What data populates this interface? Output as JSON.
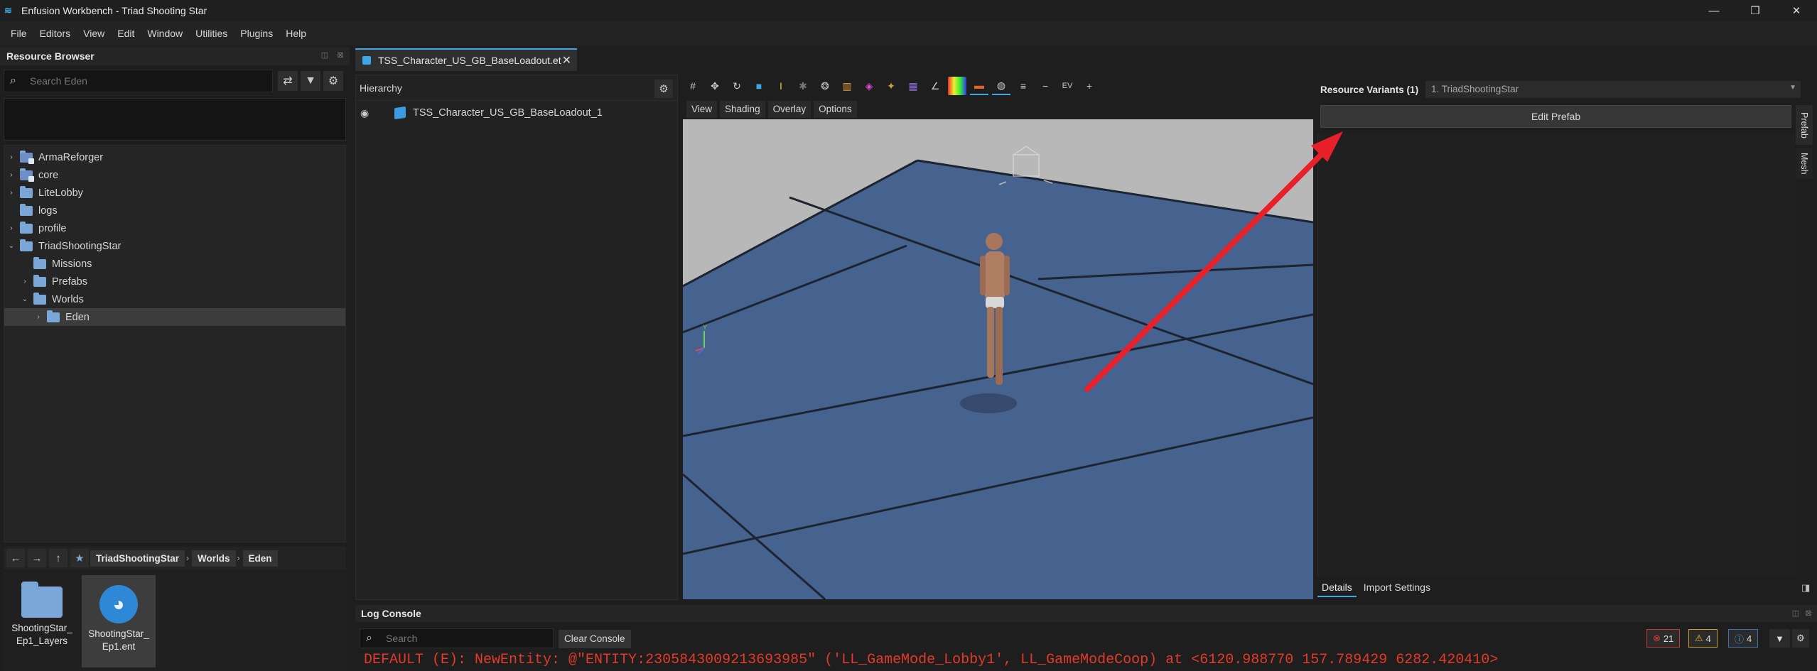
{
  "window": {
    "title": "Enfusion Workbench - Triad Shooting Star",
    "minimize": "—",
    "maximize": "❐",
    "close": "✕"
  },
  "menu": [
    "File",
    "Editors",
    "View",
    "Edit",
    "Window",
    "Utilities",
    "Plugins",
    "Help"
  ],
  "resource_browser": {
    "title": "Resource Browser",
    "search_placeholder": "Search Eden",
    "tree": [
      {
        "label": "ArmaReforger",
        "arrow": "›",
        "kind": "pkg"
      },
      {
        "label": "core",
        "arrow": "›",
        "kind": "pkg"
      },
      {
        "label": "LiteLobby",
        "arrow": "›",
        "kind": "folder"
      },
      {
        "label": "logs",
        "arrow": "",
        "kind": "folder"
      },
      {
        "label": "profile",
        "arrow": "›",
        "kind": "folder"
      },
      {
        "label": "TriadShootingStar",
        "arrow": "⌄",
        "kind": "folder"
      },
      {
        "label": "Missions",
        "arrow": "",
        "kind": "folder"
      },
      {
        "label": "Prefabs",
        "arrow": "›",
        "kind": "folder"
      },
      {
        "label": "Worlds",
        "arrow": "⌄",
        "kind": "folder"
      },
      {
        "label": "Eden",
        "arrow": "›",
        "kind": "folder"
      }
    ],
    "breadcrumb": [
      "TriadShootingStar",
      "Worlds",
      "Eden"
    ],
    "files": [
      {
        "line1": "ShootingStar_",
        "line2": "Ep1_Layers"
      },
      {
        "line1": "ShootingStar_",
        "line2": "Ep1.ent"
      }
    ]
  },
  "doc_tab": {
    "label": "TSS_Character_US_GB_BaseLoadout.et",
    "close": "✕"
  },
  "hierarchy": {
    "title": "Hierarchy",
    "row": "TSS_Character_US_GB_BaseLoadout_1"
  },
  "viewport": {
    "menus": [
      "View",
      "Shading",
      "Overlay",
      "Options"
    ],
    "axis_y": "Y"
  },
  "resource_variants": {
    "title": "Resource Variants (1)",
    "selected": "1. TriadShootingStar",
    "edit_button": "Edit Prefab",
    "side_tabs": [
      "Prefab",
      "Mesh"
    ],
    "bottom_tabs": [
      "Details",
      "Import Settings"
    ]
  },
  "log_console": {
    "title": "Log Console",
    "search_placeholder": "Search",
    "clear_label": "Clear Console",
    "errors": "21",
    "warnings": "4",
    "infos": "4",
    "line": "DEFAULT   (E):   NewEntity: @\"ENTITY:2305843009213693985\" ('LL_GameMode_Lobby1', LL_GameModeCoop) at <6120.988770 157.789429 6282.420410>"
  },
  "colors": {
    "accent": "#3da5e8",
    "error": "#e33a2a",
    "arrow": "#e8202a",
    "floor": "#46628f"
  }
}
